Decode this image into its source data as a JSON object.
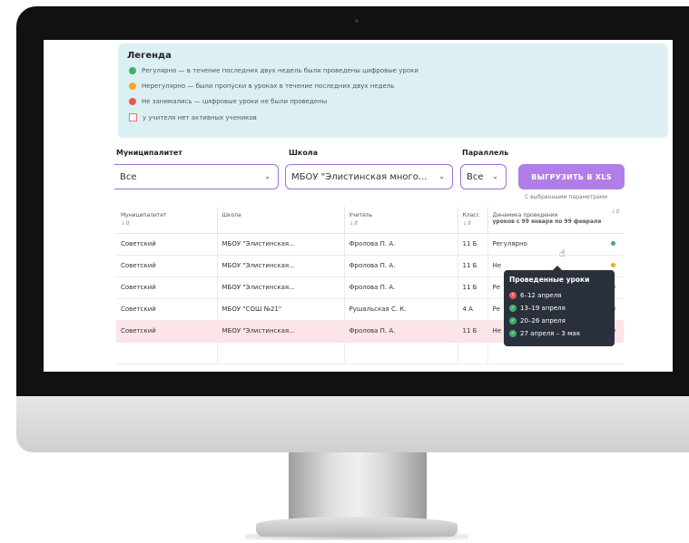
{
  "legend": {
    "title": "Легенда",
    "items": [
      {
        "label": "Регулярно — в течение последних двух недель были проведены цифровые уроки",
        "color": "#3fae6a",
        "icon": "green-dot-icon"
      },
      {
        "label": "Нерегулярно — были пропуски в уроках в течение последних двух недель",
        "color": "#f5a623",
        "icon": "orange-dot-icon"
      },
      {
        "label": "Не занимались — цифровые уроки не были проведены",
        "color": "#e8584f",
        "icon": "red-dot-icon"
      },
      {
        "label": "у учителя нет активных учеников",
        "color": "#e57373",
        "icon": "empty-square-icon"
      }
    ]
  },
  "filters": {
    "municipality": {
      "label": "Муниципалитет",
      "value": "Все"
    },
    "school": {
      "label": "Школа",
      "value": "МБОУ \"Элистинская много..."
    },
    "grade": {
      "label": "Параллель",
      "value": "Все"
    },
    "export_button": "ВЫГРУЗИТЬ В XLS",
    "export_note": "С выбранными параметрами"
  },
  "table": {
    "headers": {
      "municipality": "Муниципалитет",
      "school": "Школа",
      "teacher": "Учитель",
      "grade": "Класс",
      "dynamics_line1": "Динамика проведения",
      "dynamics_line2": "уроков с 99 января по 99 февраля",
      "sort_icon": "↓⇵"
    },
    "rows": [
      {
        "municipality": "Советский",
        "school": "МБОУ \"Элистинская...",
        "teacher": "Фролова П. А.",
        "grade": "11 Б",
        "dynamics": "Регулярно",
        "status_color": "#3fae6a"
      },
      {
        "municipality": "Советский",
        "school": "МБОУ \"Элистинская...",
        "teacher": "Фролова П. А.",
        "grade": "11 Б",
        "dynamics": "Не",
        "status_color": "#f5a623"
      },
      {
        "municipality": "Советский",
        "school": "МБОУ \"Элистинская...",
        "teacher": "Фролова П. А.",
        "grade": "11 Б",
        "dynamics": "Ре",
        "status_color": "#3fae6a"
      },
      {
        "municipality": "Советский",
        "school": "МБОУ \"СОШ №21\"",
        "teacher": "Рушальская С. К.",
        "grade": "4 А",
        "dynamics": "Ре",
        "status_color": "#3fae6a"
      },
      {
        "municipality": "Советский",
        "school": "МБОУ \"Элистинская...",
        "teacher": "Фролова П. А.",
        "grade": "11 Б",
        "dynamics": "Не",
        "status_color": "#e8584f"
      }
    ]
  },
  "tooltip": {
    "title": "Проведенные уроки",
    "items": [
      {
        "label": "6–12 апреля",
        "status": "missed",
        "color": "#e8584f",
        "icon": "exclamation-icon"
      },
      {
        "label": "13–19 апреля",
        "status": "done",
        "color": "#3fae6a",
        "icon": "check-icon"
      },
      {
        "label": "20–26 апреля",
        "status": "done",
        "color": "#3fae6a",
        "icon": "check-icon"
      },
      {
        "label": "27 апреля – 3 мая",
        "status": "done",
        "color": "#3fae6a",
        "icon": "check-icon"
      }
    ]
  },
  "colors": {
    "accent": "#b07ee6",
    "legend_bg": "#dcf0f4",
    "highlight_row": "#fde4e8"
  }
}
